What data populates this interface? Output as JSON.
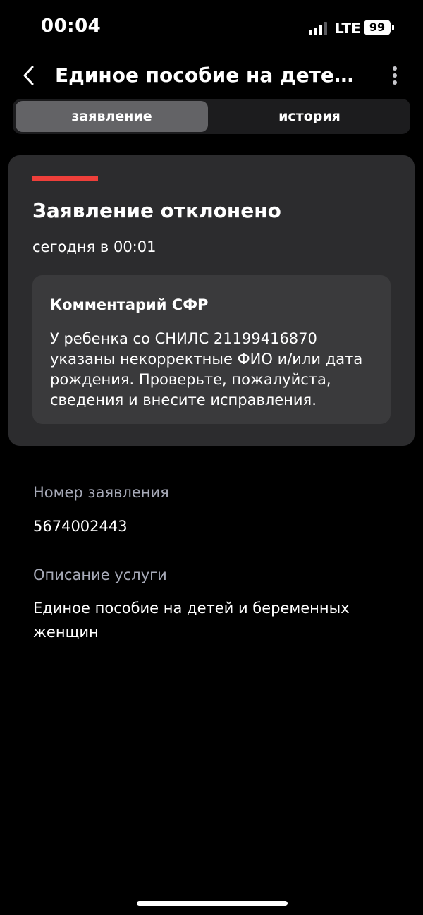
{
  "status_bar": {
    "time": "00:04",
    "network": "LTE",
    "battery": "99",
    "icons": [
      "signal-icon",
      "battery-icon"
    ]
  },
  "header": {
    "title": "Единое пособие на детей...",
    "back_icon": "chevron-left-icon",
    "more_icon": "more-vertical-icon"
  },
  "tabs": [
    {
      "label": "заявление",
      "active": true
    },
    {
      "label": "история",
      "active": false
    }
  ],
  "status_card": {
    "title": "Заявление отклонено",
    "date": "сегодня в 00:01",
    "accent_color": "#ee3f3a",
    "comment": {
      "title": "Комментарий СФР",
      "text": "У ребенка со СНИЛС 21199416870 указаны некорректные ФИО и/или дата рождения. Проверьте, пожалуйста, сведения и внесите исправления."
    }
  },
  "details": {
    "application_number_label": "Номер заявления",
    "application_number": "5674002443",
    "service_description_label": "Описание услуги",
    "service_description": "Единое пособие на детей и беременных женщин"
  },
  "colors": {
    "background": "#000000",
    "card": "#2c2c2e",
    "comment_box": "#3a3a3c",
    "secondary_text": "#a7aab8"
  }
}
